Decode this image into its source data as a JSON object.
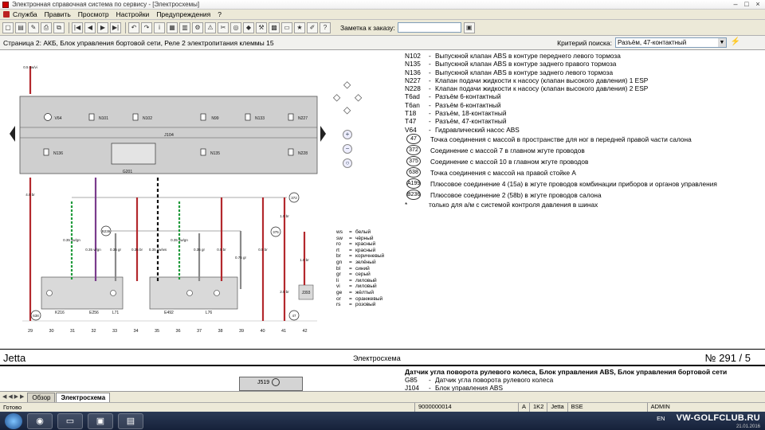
{
  "window": {
    "title": "Электронная справочная система по сервису - [Электросхемы]"
  },
  "menu": [
    "Служба",
    "Править",
    "Просмотр",
    "Настройки",
    "Предупреждения",
    "?"
  ],
  "toolbar": {
    "note_label": "Заметка к заказу:",
    "note_value": ""
  },
  "breadcrumb": "Страница 2: АКБ, Блок управления бортовой сети, Реле 2 электропитания клеммы 15",
  "search": {
    "label": "Критерий поиска:",
    "value": "Разъём, 47-контактный"
  },
  "legend": [
    {
      "code": "N102",
      "desc": "Выпускной клапан ABS в контуре переднего левого тормоза"
    },
    {
      "code": "N135",
      "desc": "Выпускной клапан ABS в контуре заднего правого тормоза"
    },
    {
      "code": "N136",
      "desc": "Выпускной клапан ABS в контуре заднего левого тормоза"
    },
    {
      "code": "N227",
      "desc": "Клапан подачи жидкости к насосу (клапан высокого давления) 1 ESP"
    },
    {
      "code": "N228",
      "desc": "Клапан подачи жидкости к насосу (клапан высокого давления) 2 ESP"
    },
    {
      "code": "T6ad",
      "desc": "Разъём 6-контактный"
    },
    {
      "code": "T6an",
      "desc": "Разъём 6-контактный"
    },
    {
      "code": "T18",
      "desc": "Разъём, 18-контактный"
    },
    {
      "code": "T47",
      "desc": "Разъём, 47-контактный"
    },
    {
      "code": "V64",
      "desc": "Гидравлический насос ABS"
    }
  ],
  "legend_circles": [
    {
      "code": "47",
      "desc": "Точка соединения с массой в пространстве для ног в передней правой части салона"
    },
    {
      "code": "372",
      "desc": "Соединение с массой 7 в главном жгуте проводов"
    },
    {
      "code": "375",
      "desc": "Соединение с массой 10 в главном жгуте проводов"
    },
    {
      "code": "638",
      "desc": "Точка соединения с массой на правой стойке A"
    },
    {
      "code": "A199",
      "desc": "Плюсовое соединение 4 (15а) в жгуте проводов комбинации приборов и органов управления"
    },
    {
      "code": "B236",
      "desc": "Плюсовое соединение 2 (58b) в жгуте проводов салона"
    }
  ],
  "legend_note": {
    "code": "*",
    "desc": "только для а/м с системой контроля давления в шинах"
  },
  "diagram": {
    "valves_top": [
      "V64",
      "N101",
      "N102",
      "N99",
      "N133",
      "N227"
    ],
    "valves_bottom": [
      "N136",
      "N135",
      "N228"
    ],
    "block": "J104",
    "sensor": "G201",
    "components_bottom": [
      "K216",
      "E256",
      "L71",
      "E492",
      "L76",
      "J393"
    ],
    "wire_labels": [
      "0.35 sw/gn",
      "0.35 vi/gn",
      "0.35 gr",
      "0.35 br",
      "0.35 sw/ws",
      "0.35 sw/gn",
      "0.35 gr",
      "0.5 br",
      "0.75 gr",
      "0.5 br",
      "1.0 br",
      "2.5 br",
      "1.0 br",
      "4.0 br",
      "0.5 sw/vi"
    ],
    "ground_marks": [
      "638",
      "372",
      "375",
      "47",
      "B236"
    ],
    "columns": [
      "29",
      "30",
      "31",
      "32",
      "33",
      "34",
      "35",
      "36",
      "37",
      "38",
      "39",
      "40",
      "41",
      "42"
    ],
    "color_codes": [
      [
        "ws",
        "белый"
      ],
      [
        "sw",
        "чёрный"
      ],
      [
        "ro",
        "красный"
      ],
      [
        "rt",
        "красный"
      ],
      [
        "br",
        "коричневый"
      ],
      [
        "gn",
        "зелёный"
      ],
      [
        "bl",
        "синий"
      ],
      [
        "gr",
        "серый"
      ],
      [
        "li",
        "лиловый"
      ],
      [
        "vi",
        "лиловый"
      ],
      [
        "ge",
        "жёлтый"
      ],
      [
        "or",
        "оранжевый"
      ],
      [
        "rs",
        "розовый"
      ]
    ]
  },
  "footer": {
    "car": "Jetta",
    "center": "Электросхема",
    "page": "№  291 / 5"
  },
  "next_section": {
    "heading": "Датчик угла поворота рулевого колеса, Блок управления ABS, Блок управления бортовой сети",
    "items": [
      {
        "code": "G85",
        "desc": "Датчик угла поворота рулевого колеса"
      },
      {
        "code": "J104",
        "desc": "Блок управления ABS"
      }
    ],
    "block_label": "J519"
  },
  "tabs": [
    "Обзор",
    "Электросхема"
  ],
  "status": {
    "text": "Готово",
    "code": "9000000014",
    "a": "A",
    "b": "1K2",
    "car": "Jetta",
    "c": "BSE",
    "user": "ADMIN"
  },
  "taskbar": {
    "lang": "EN",
    "brand": "VW-GOLFCLUB.RU",
    "date": "21.01.2016"
  },
  "colors": {
    "wire_red": "#b3282d",
    "wire_green": "#1f9a3a",
    "wire_gray": "#8a8a8a",
    "wire_black": "#111111",
    "wire_violet": "#7a3c8c",
    "block_fill": "#cfcfcf"
  }
}
